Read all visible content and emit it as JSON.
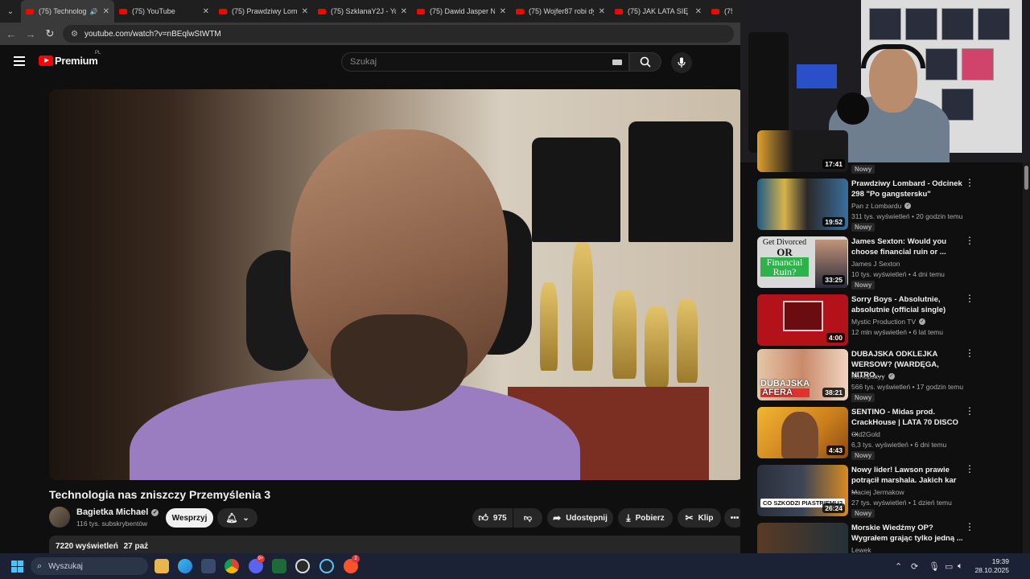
{
  "browser": {
    "tabs": [
      {
        "label": "(75) Technologia",
        "active": true,
        "audio": true
      },
      {
        "label": "(75) YouTube"
      },
      {
        "label": "(75) Prawdziwy Lomb"
      },
      {
        "label": "(75) SzklanaY2J - You"
      },
      {
        "label": "(75) Dawid Jasper NA"
      },
      {
        "label": "(75) Wojfer87 robi dy"
      },
      {
        "label": "(75) JAK LATA SIĘ PO"
      },
      {
        "label": "(75"
      }
    ],
    "url": "youtube.com/watch?v=nBEqlwStWTM"
  },
  "youtube": {
    "logo_text": "Premium",
    "country_code": "PL",
    "search_placeholder": "Szukaj"
  },
  "video": {
    "title": "Technologia nas zniszczy Przemyślenia 3",
    "channel": "Bagietka Michael",
    "subscribers": "116 tys. subskrybentów",
    "support_label": "Wesprzyj",
    "likes": "975",
    "share_label": "Udostępnij",
    "download_label": "Pobierz",
    "clip_label": "Klip",
    "views": "7220 wyświetleń",
    "date": "27 paź"
  },
  "sidebar": {
    "partial_duration": "17:41",
    "partial_badge": "Nowy",
    "items": [
      {
        "title": "Prawdziwy Lombard - Odcinek 298 \"Po gangstersku\"",
        "channel": "Pan z Lombardu",
        "verified": true,
        "meta": "311 tys. wyświetleń • 20 godzin temu",
        "badge": "Nowy",
        "duration": "19:52"
      },
      {
        "title": "James Sexton: Would you choose financial ruin or ...",
        "channel": "James J Sexton",
        "verified": false,
        "meta": "10 tys. wyświetleń • 4 dni temu",
        "badge": "Nowy",
        "duration": "33:25",
        "thumb_text": [
          "Get Divorced",
          "OR",
          "Financial",
          "Ruin?"
        ]
      },
      {
        "title": "Sorry Boys - Absolutnie, absolutnie (official single)",
        "channel": "Mystic Production TV",
        "verified": true,
        "meta": "12 mln wyświetleń • 6 lat temu",
        "badge": "",
        "duration": "4:00"
      },
      {
        "title": "DUBAJSKA ODKLEJKA WERSOW? (WARDĘGA, NITRO,...",
        "channel": "Konopskyy",
        "verified": true,
        "meta": "566 tys. wyświetleń • 17 godzin temu",
        "badge": "Nowy",
        "duration": "38:21",
        "thumb_text": [
          "DUBAJSKA",
          "AFERA"
        ]
      },
      {
        "title": "SENTINO - Midas prod. CrackHouse | LATA 70 DISCO ...",
        "channel": "Old2Gold",
        "verified": false,
        "meta": "6,3 tys. wyświetleń • 6 dni temu",
        "badge": "Nowy",
        "duration": "4:43"
      },
      {
        "title": "Nowy lider! Lawson prawie potrącił marshala. Jakich kar ...",
        "channel": "Maciej Jermakow",
        "verified": false,
        "meta": "27 tys. wyświetleń • 1 dzień temu",
        "badge": "Nowy",
        "duration": "26:24",
        "thumb_text": [
          "CO SZKODZI PIASTRIEMU?"
        ]
      },
      {
        "title": "Morskie Wiedźmy OP? Wygrałem grając tylko jedną ...",
        "channel": "Lewek",
        "verified": false,
        "meta": "",
        "badge": "",
        "duration": ""
      }
    ]
  },
  "taskbar": {
    "search_placeholder": "Wyszukaj",
    "time": "19:39",
    "date": "28.10.2025",
    "discord_badge": "9+",
    "brave_badge": "2"
  },
  "colors": {
    "yt_red": "#ff0000",
    "bg": "#0f0f0f",
    "chip": "#272727"
  }
}
